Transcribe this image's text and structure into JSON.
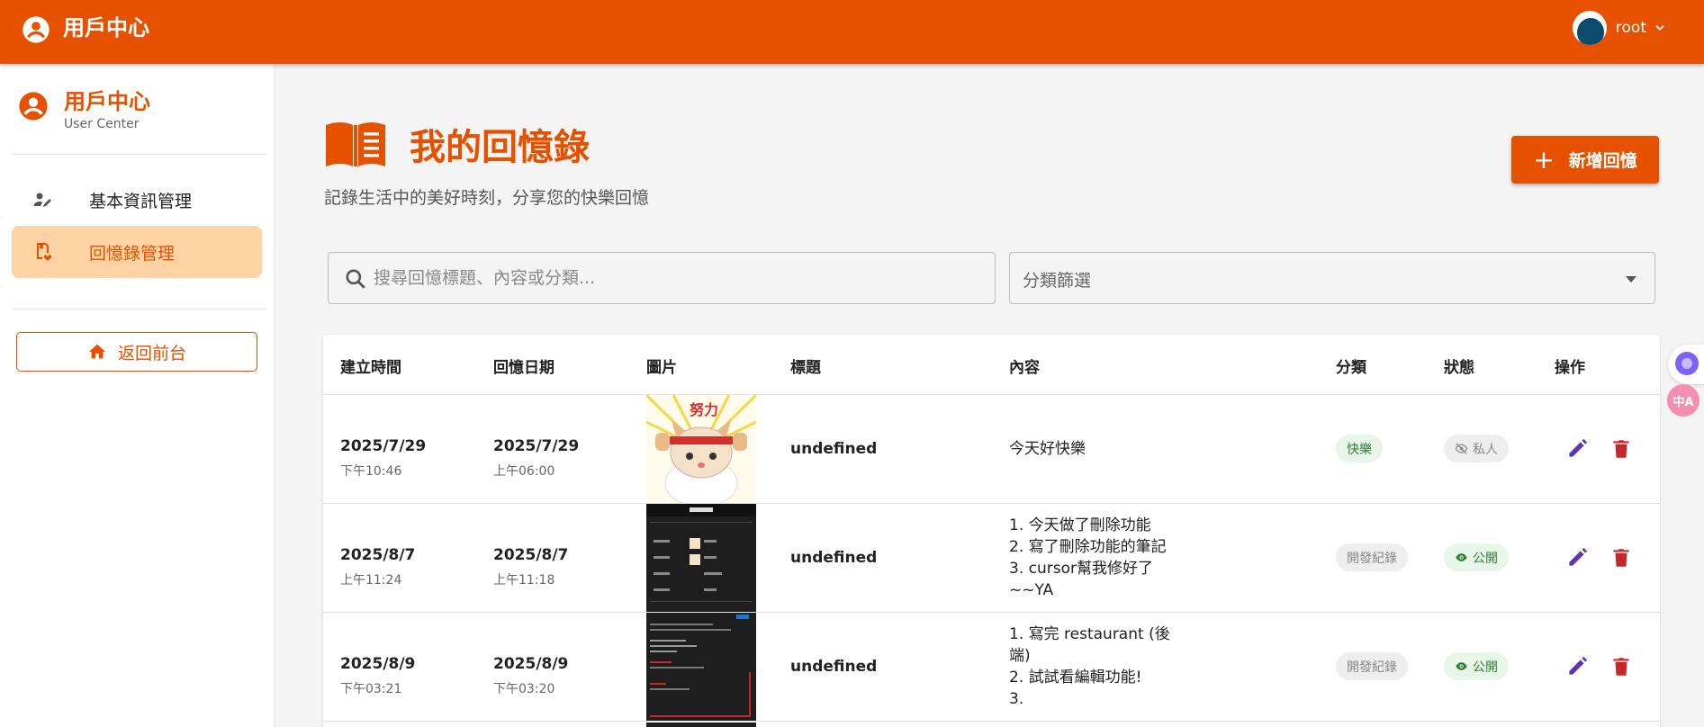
{
  "appbar": {
    "title": "用戶中心",
    "username": "root"
  },
  "sidebar": {
    "title": "用戶中心",
    "subtitle": "User Center",
    "items": [
      {
        "label": "基本資訊管理",
        "icon": "person-edit-icon",
        "active": false
      },
      {
        "label": "回憶錄管理",
        "icon": "memory-bookmark-icon",
        "active": true
      }
    ],
    "back_label": "返回前台"
  },
  "main": {
    "title": "我的回憶錄",
    "subtitle": "記錄生活中的美好時刻，分享您的快樂回憶",
    "add_label": "新增回憶",
    "search_placeholder": "搜尋回憶標題、內容或分類...",
    "filter_label": "分類篩選"
  },
  "table": {
    "headers": [
      "建立時間",
      "回憶日期",
      "圖片",
      "標題",
      "內容",
      "分類",
      "狀態",
      "操作"
    ],
    "rows": [
      {
        "created_date": "2025/7/29",
        "created_time": "下午10:46",
        "memory_date": "2025/7/29",
        "memory_time": "上午06:00",
        "title": "undefined",
        "content": [
          "今天好快樂"
        ],
        "category": "快樂",
        "status": "私人",
        "status_icon": "eye-off-icon"
      },
      {
        "created_date": "2025/8/7",
        "created_time": "上午11:24",
        "memory_date": "2025/8/7",
        "memory_time": "上午11:18",
        "title": "undefined",
        "content": [
          "1.  今天做了刪除功能",
          "2.  寫了刪除功能的筆記",
          "3.  cursor幫我修好了",
          "~~YA"
        ],
        "category": "開發紀錄",
        "status": "公開",
        "status_icon": "eye-icon"
      },
      {
        "created_date": "2025/8/9",
        "created_time": "下午03:21",
        "memory_date": "2025/8/9",
        "memory_time": "下午03:20",
        "title": "undefined",
        "content": [
          "1. 寫完 restaurant (後",
          "端)",
          "2. 試試看編輯功能!",
          "3."
        ],
        "category": "開發紀錄",
        "status": "公開",
        "status_icon": "eye-icon"
      }
    ]
  },
  "colors": {
    "primary": "#e65100",
    "active_bg": "#ffd3a4",
    "success": "#2e7d32",
    "danger": "#c62828",
    "edit": "#5e35b1"
  }
}
